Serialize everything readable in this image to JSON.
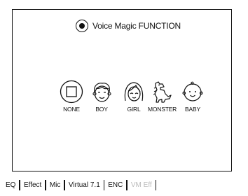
{
  "panel": {
    "title": "Voice Magic FUNCTION",
    "selected": true
  },
  "voices": [
    {
      "id": "none",
      "label": "NONE",
      "icon": "square-icon"
    },
    {
      "id": "boy",
      "label": "BOY",
      "icon": "boy-face-icon"
    },
    {
      "id": "girl",
      "label": "GIRL",
      "icon": "girl-face-icon"
    },
    {
      "id": "monster",
      "label": "MONSTER",
      "icon": "dinosaur-icon"
    },
    {
      "id": "baby",
      "label": "BABY",
      "icon": "baby-face-icon"
    }
  ],
  "tabs": [
    {
      "label": "EQ"
    },
    {
      "label": "Effect"
    },
    {
      "label": "Mic"
    },
    {
      "label": "Virtual 7.1"
    },
    {
      "label": "ENC"
    },
    {
      "label": "VM Eff",
      "disabled": true
    }
  ]
}
